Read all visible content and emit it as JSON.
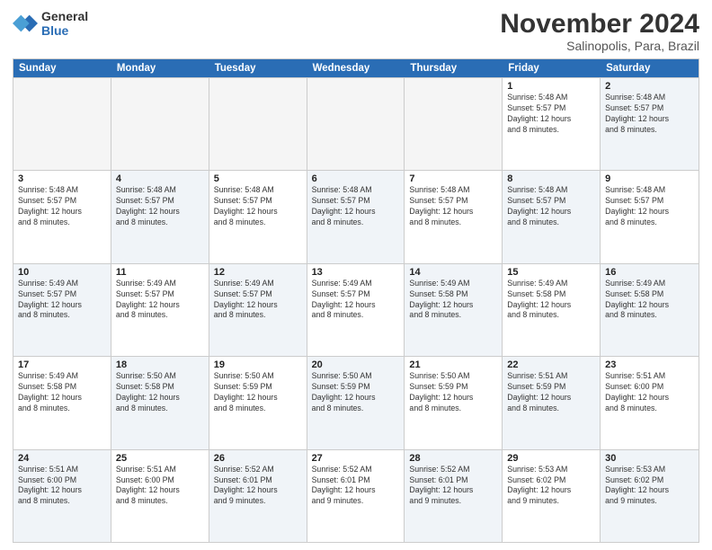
{
  "logo": {
    "line1": "General",
    "line2": "Blue"
  },
  "title": "November 2024",
  "location": "Salinopolis, Para, Brazil",
  "day_headers": [
    "Sunday",
    "Monday",
    "Tuesday",
    "Wednesday",
    "Thursday",
    "Friday",
    "Saturday"
  ],
  "weeks": [
    [
      {
        "num": "",
        "info": "",
        "empty": true
      },
      {
        "num": "",
        "info": "",
        "empty": true
      },
      {
        "num": "",
        "info": "",
        "empty": true
      },
      {
        "num": "",
        "info": "",
        "empty": true
      },
      {
        "num": "",
        "info": "",
        "empty": true
      },
      {
        "num": "1",
        "info": "Sunrise: 5:48 AM\nSunset: 5:57 PM\nDaylight: 12 hours\nand 8 minutes.",
        "empty": false
      },
      {
        "num": "2",
        "info": "Sunrise: 5:48 AM\nSunset: 5:57 PM\nDaylight: 12 hours\nand 8 minutes.",
        "empty": false
      }
    ],
    [
      {
        "num": "3",
        "info": "Sunrise: 5:48 AM\nSunset: 5:57 PM\nDaylight: 12 hours\nand 8 minutes.",
        "empty": false
      },
      {
        "num": "4",
        "info": "Sunrise: 5:48 AM\nSunset: 5:57 PM\nDaylight: 12 hours\nand 8 minutes.",
        "empty": false
      },
      {
        "num": "5",
        "info": "Sunrise: 5:48 AM\nSunset: 5:57 PM\nDaylight: 12 hours\nand 8 minutes.",
        "empty": false
      },
      {
        "num": "6",
        "info": "Sunrise: 5:48 AM\nSunset: 5:57 PM\nDaylight: 12 hours\nand 8 minutes.",
        "empty": false
      },
      {
        "num": "7",
        "info": "Sunrise: 5:48 AM\nSunset: 5:57 PM\nDaylight: 12 hours\nand 8 minutes.",
        "empty": false
      },
      {
        "num": "8",
        "info": "Sunrise: 5:48 AM\nSunset: 5:57 PM\nDaylight: 12 hours\nand 8 minutes.",
        "empty": false
      },
      {
        "num": "9",
        "info": "Sunrise: 5:48 AM\nSunset: 5:57 PM\nDaylight: 12 hours\nand 8 minutes.",
        "empty": false
      }
    ],
    [
      {
        "num": "10",
        "info": "Sunrise: 5:49 AM\nSunset: 5:57 PM\nDaylight: 12 hours\nand 8 minutes.",
        "empty": false
      },
      {
        "num": "11",
        "info": "Sunrise: 5:49 AM\nSunset: 5:57 PM\nDaylight: 12 hours\nand 8 minutes.",
        "empty": false
      },
      {
        "num": "12",
        "info": "Sunrise: 5:49 AM\nSunset: 5:57 PM\nDaylight: 12 hours\nand 8 minutes.",
        "empty": false
      },
      {
        "num": "13",
        "info": "Sunrise: 5:49 AM\nSunset: 5:57 PM\nDaylight: 12 hours\nand 8 minutes.",
        "empty": false
      },
      {
        "num": "14",
        "info": "Sunrise: 5:49 AM\nSunset: 5:58 PM\nDaylight: 12 hours\nand 8 minutes.",
        "empty": false
      },
      {
        "num": "15",
        "info": "Sunrise: 5:49 AM\nSunset: 5:58 PM\nDaylight: 12 hours\nand 8 minutes.",
        "empty": false
      },
      {
        "num": "16",
        "info": "Sunrise: 5:49 AM\nSunset: 5:58 PM\nDaylight: 12 hours\nand 8 minutes.",
        "empty": false
      }
    ],
    [
      {
        "num": "17",
        "info": "Sunrise: 5:49 AM\nSunset: 5:58 PM\nDaylight: 12 hours\nand 8 minutes.",
        "empty": false
      },
      {
        "num": "18",
        "info": "Sunrise: 5:50 AM\nSunset: 5:58 PM\nDaylight: 12 hours\nand 8 minutes.",
        "empty": false
      },
      {
        "num": "19",
        "info": "Sunrise: 5:50 AM\nSunset: 5:59 PM\nDaylight: 12 hours\nand 8 minutes.",
        "empty": false
      },
      {
        "num": "20",
        "info": "Sunrise: 5:50 AM\nSunset: 5:59 PM\nDaylight: 12 hours\nand 8 minutes.",
        "empty": false
      },
      {
        "num": "21",
        "info": "Sunrise: 5:50 AM\nSunset: 5:59 PM\nDaylight: 12 hours\nand 8 minutes.",
        "empty": false
      },
      {
        "num": "22",
        "info": "Sunrise: 5:51 AM\nSunset: 5:59 PM\nDaylight: 12 hours\nand 8 minutes.",
        "empty": false
      },
      {
        "num": "23",
        "info": "Sunrise: 5:51 AM\nSunset: 6:00 PM\nDaylight: 12 hours\nand 8 minutes.",
        "empty": false
      }
    ],
    [
      {
        "num": "24",
        "info": "Sunrise: 5:51 AM\nSunset: 6:00 PM\nDaylight: 12 hours\nand 8 minutes.",
        "empty": false
      },
      {
        "num": "25",
        "info": "Sunrise: 5:51 AM\nSunset: 6:00 PM\nDaylight: 12 hours\nand 8 minutes.",
        "empty": false
      },
      {
        "num": "26",
        "info": "Sunrise: 5:52 AM\nSunset: 6:01 PM\nDaylight: 12 hours\nand 9 minutes.",
        "empty": false
      },
      {
        "num": "27",
        "info": "Sunrise: 5:52 AM\nSunset: 6:01 PM\nDaylight: 12 hours\nand 9 minutes.",
        "empty": false
      },
      {
        "num": "28",
        "info": "Sunrise: 5:52 AM\nSunset: 6:01 PM\nDaylight: 12 hours\nand 9 minutes.",
        "empty": false
      },
      {
        "num": "29",
        "info": "Sunrise: 5:53 AM\nSunset: 6:02 PM\nDaylight: 12 hours\nand 9 minutes.",
        "empty": false
      },
      {
        "num": "30",
        "info": "Sunrise: 5:53 AM\nSunset: 6:02 PM\nDaylight: 12 hours\nand 9 minutes.",
        "empty": false
      }
    ]
  ]
}
